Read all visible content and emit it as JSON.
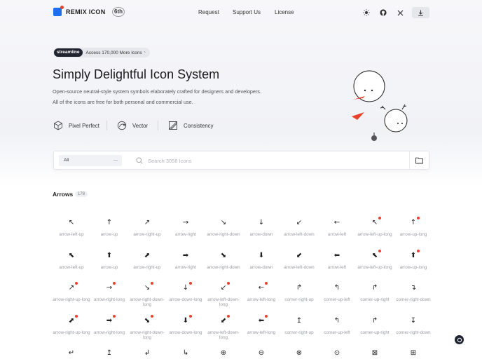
{
  "header": {
    "logo_text": "REMIX ICON",
    "badge": "6th",
    "nav": [
      "Request",
      "Support Us",
      "License"
    ],
    "icons": [
      "sun-icon",
      "github-icon",
      "x-icon",
      "download-icon"
    ]
  },
  "hero": {
    "promo_brand": "streamline",
    "promo_text": "Access 170,000 More Icons",
    "title": "Simply Delightful Icon System",
    "desc1": "Open-source neutral-style system symbols elaborately crafted for designers and developers.",
    "desc2": "All of the icons are free for both personal and commercial use.",
    "features": [
      "Pixel Perfect",
      "Vector",
      "Consistency"
    ]
  },
  "search": {
    "category": "All",
    "placeholder": "Search 3058 Icons"
  },
  "section": {
    "title": "Arrows",
    "count": "178"
  },
  "icons": [
    [
      {
        "glyph": "↖",
        "name": "arrow-left-up",
        "new": false
      },
      {
        "glyph": "↑",
        "name": "arrow-up",
        "new": false
      },
      {
        "glyph": "↗",
        "name": "arrow-right-up",
        "new": false
      },
      {
        "glyph": "→",
        "name": "arrow-right",
        "new": false
      },
      {
        "glyph": "↘",
        "name": "arrow-right-down",
        "new": false
      },
      {
        "glyph": "↓",
        "name": "arrow-down",
        "new": false
      },
      {
        "glyph": "↙",
        "name": "arrow-left-down",
        "new": false
      },
      {
        "glyph": "←",
        "name": "arrow-left",
        "new": false
      },
      {
        "glyph": "↖",
        "name": "arrow-left-up-long",
        "new": true
      },
      {
        "glyph": "↑",
        "name": "arrow-up-long",
        "new": true
      }
    ],
    [
      {
        "glyph": "⬉",
        "name": "arrow-left-up",
        "new": false
      },
      {
        "glyph": "⬆",
        "name": "arrow-up",
        "new": false
      },
      {
        "glyph": "⬈",
        "name": "arrow-right-up",
        "new": false
      },
      {
        "glyph": "➡",
        "name": "arrow-right",
        "new": false
      },
      {
        "glyph": "⬊",
        "name": "arrow-right-down",
        "new": false
      },
      {
        "glyph": "⬇",
        "name": "arrow-down",
        "new": false
      },
      {
        "glyph": "⬋",
        "name": "arrow-left-down",
        "new": false
      },
      {
        "glyph": "⬅",
        "name": "arrow-left",
        "new": false
      },
      {
        "glyph": "⬉",
        "name": "arrow-left-up-long",
        "new": true
      },
      {
        "glyph": "⬆",
        "name": "arrow-up-long",
        "new": true
      }
    ],
    [
      {
        "glyph": "↗",
        "name": "arrow-right-up-long",
        "new": true
      },
      {
        "glyph": "→",
        "name": "arrow-right-long",
        "new": true
      },
      {
        "glyph": "↘",
        "name": "arrow-right-down-long",
        "new": true
      },
      {
        "glyph": "↓",
        "name": "arrow-down-long",
        "new": true
      },
      {
        "glyph": "↙",
        "name": "arrow-left-down-long",
        "new": true
      },
      {
        "glyph": "←",
        "name": "arrow-left-long",
        "new": true
      },
      {
        "glyph": "↱",
        "name": "corner-right-up",
        "new": false
      },
      {
        "glyph": "↰",
        "name": "corner-up-left",
        "new": false
      },
      {
        "glyph": "↱",
        "name": "corner-up-right",
        "new": false
      },
      {
        "glyph": "↴",
        "name": "corner-right-down",
        "new": false
      }
    ],
    [
      {
        "glyph": "⬈",
        "name": "arrow-right-up-long",
        "new": true
      },
      {
        "glyph": "➡",
        "name": "arrow-right-long",
        "new": true
      },
      {
        "glyph": "⬊",
        "name": "arrow-right-down-long",
        "new": true
      },
      {
        "glyph": "⬇",
        "name": "arrow-down-long",
        "new": true
      },
      {
        "glyph": "⬋",
        "name": "arrow-left-down-long",
        "new": true
      },
      {
        "glyph": "⬅",
        "name": "arrow-left-long",
        "new": true
      },
      {
        "glyph": "↥",
        "name": "corner-right-up",
        "new": false
      },
      {
        "glyph": "↰",
        "name": "corner-up-left",
        "new": false
      },
      {
        "glyph": "↱",
        "name": "corner-up-right",
        "new": false
      },
      {
        "glyph": "↧",
        "name": "corner-right-down",
        "new": false
      }
    ],
    [
      {
        "glyph": "↵",
        "name": "",
        "new": false
      },
      {
        "glyph": "↥",
        "name": "",
        "new": false
      },
      {
        "glyph": "↲",
        "name": "",
        "new": false
      },
      {
        "glyph": "↳",
        "name": "",
        "new": false
      },
      {
        "glyph": "⊕",
        "name": "",
        "new": false
      },
      {
        "glyph": "⊖",
        "name": "",
        "new": false
      },
      {
        "glyph": "⊗",
        "name": "",
        "new": false
      },
      {
        "glyph": "⊙",
        "name": "",
        "new": false
      },
      {
        "glyph": "⊠",
        "name": "",
        "new": false
      },
      {
        "glyph": "⊞",
        "name": "",
        "new": false
      }
    ]
  ]
}
